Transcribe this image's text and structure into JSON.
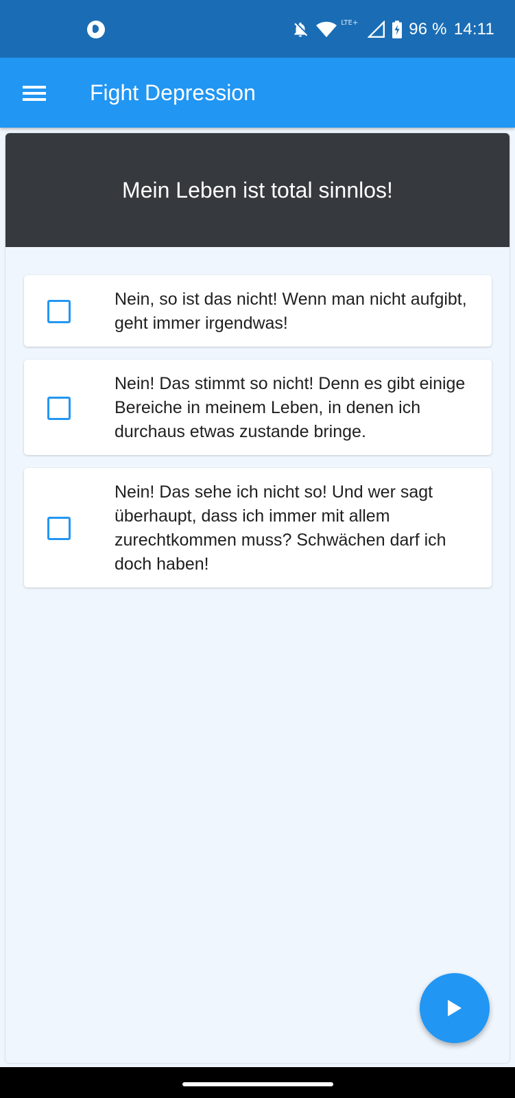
{
  "status_bar": {
    "battery": "96 %",
    "time": "14:11",
    "network": "LTE+",
    "icons": [
      "app-notification-icon",
      "notifications-off-icon",
      "wifi-icon",
      "signal-icon",
      "battery-charging-icon"
    ]
  },
  "app_bar": {
    "title": "Fight Depression",
    "menu_icon": "hamburger-menu-icon"
  },
  "question": {
    "statement": "Mein Leben ist total sinnlos!"
  },
  "options": [
    {
      "text": "Nein, so ist das nicht! Wenn man nicht aufgibt, geht immer irgendwas!",
      "checked": false
    },
    {
      "text": "Nein! Das stimmt so nicht! Denn es gibt einige Bereiche in meinem Leben, in denen ich durchaus etwas zustande bringe.",
      "checked": false
    },
    {
      "text": "Nein! Das sehe ich nicht so! Und wer sagt überhaupt, dass ich immer mit allem zurechtkommen muss? Schwächen darf ich doch haben!",
      "checked": false
    }
  ],
  "fab": {
    "icon": "play-arrow-icon"
  },
  "colors": {
    "status_bar": "#1a6db5",
    "app_bar": "#2196f3",
    "header_card": "#363a3e",
    "background": "#f0f6fd",
    "accent": "#2196f3"
  }
}
